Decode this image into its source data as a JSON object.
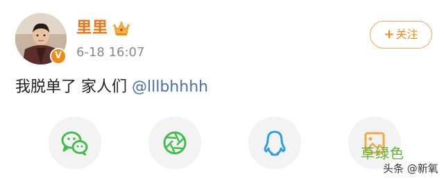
{
  "post": {
    "author_name": "里里",
    "timestamp": "6-18 16:07",
    "text_main": "我脱单了 家人们 ",
    "mention": "@lllbhhhh"
  },
  "header": {
    "follow_label": "关注"
  },
  "avatar": {
    "verified_badge": "V"
  },
  "share": {
    "icons": [
      "wechat-icon",
      "moments-icon",
      "qq-icon",
      "save-image-icon"
    ]
  },
  "watermark": {
    "green_text": "草绿色",
    "source_text": "头条 @新氧"
  },
  "colors": {
    "name_orange": "#f0720f",
    "accent_orange": "#f08a15",
    "mention_blue": "#4a6fa5",
    "wechat_green": "#3fbf4a",
    "qq_blue": "#2e9fe6",
    "save_orange": "#f4a640",
    "share_bg": "#f3f3f3",
    "watermark_green": "#63b33b"
  }
}
